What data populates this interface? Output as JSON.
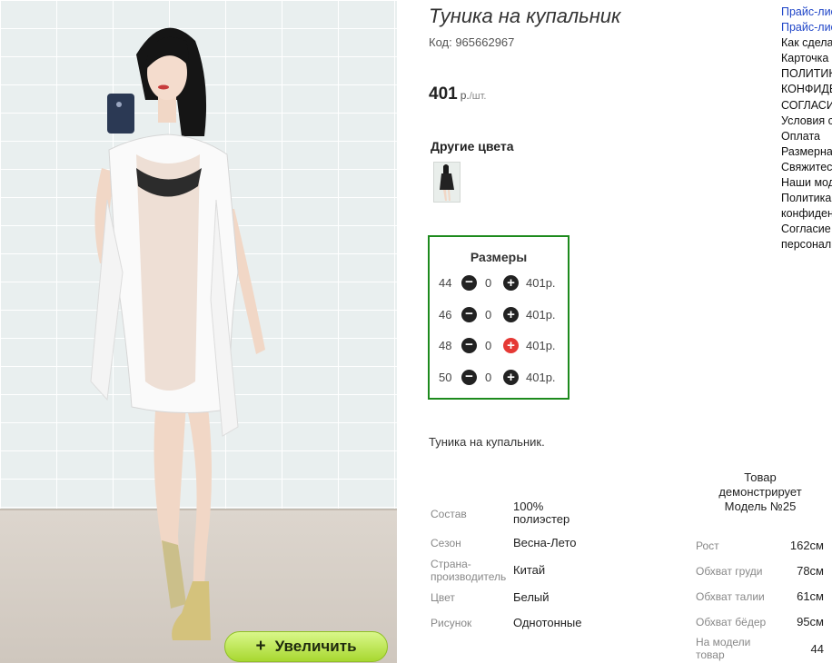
{
  "photo": {
    "zoom_button_label": "Увеличить",
    "zoom_button_icon": "plus-icon"
  },
  "product": {
    "title": "Туника на купальник",
    "code": "Код: 965662967",
    "price": "401",
    "price_unit_currency": "р.",
    "price_unit_piece": "/шт.",
    "other_colors_label": "Другие цвета",
    "sizes_title": "Размеры",
    "sizes": [
      {
        "size": "44",
        "count": "0",
        "price": "401р."
      },
      {
        "size": "46",
        "count": "0",
        "price": "401р."
      },
      {
        "size": "48",
        "count": "0",
        "price": "401р."
      },
      {
        "size": "50",
        "count": "0",
        "price": "401р."
      }
    ],
    "description": "Туника на купальник.",
    "attributes": [
      {
        "label": "Состав",
        "value": "100% полиэстер"
      },
      {
        "label": "Сезон",
        "value": "Весна-Лето"
      },
      {
        "label": "Страна-производитель",
        "value": "Китай"
      },
      {
        "label": "Цвет",
        "value": "Белый"
      },
      {
        "label": "Рисунок",
        "value": "Однотонные"
      }
    ]
  },
  "model": {
    "heading": "Товар демонстрирует Модель №25",
    "measurements": [
      {
        "label": "Рост",
        "value": "162см"
      },
      {
        "label": "Обхват груди",
        "value": "78см"
      },
      {
        "label": "Обхват талии",
        "value": "61см"
      },
      {
        "label": "Обхват бёдер",
        "value": "95см"
      },
      {
        "label": "На модели товар",
        "value": "44"
      }
    ]
  },
  "side_links": [
    {
      "label": "Прайс-лист",
      "link": true
    },
    {
      "label": "Прайс-лист",
      "link": true
    },
    {
      "label": "Как сделать заказ",
      "link": false
    },
    {
      "label": "Карточка",
      "link": false
    },
    {
      "label": "ПОЛИТИКА",
      "link": false
    },
    {
      "label": "КОНФИДЕНЦИАЛЬНОСТИ",
      "link": false
    },
    {
      "label": "СОГЛАСИЕ",
      "link": false
    },
    {
      "label": "Условия сотрудничества",
      "link": false
    },
    {
      "label": "Оплата",
      "link": false
    },
    {
      "label": "Размерная сетка",
      "link": false
    },
    {
      "label": "Свяжитесь с нами",
      "link": false
    },
    {
      "label": "Наши модели",
      "link": false
    },
    {
      "label": "Политика",
      "link": false
    },
    {
      "label": "конфиденциальности",
      "link": false
    },
    {
      "label": "Согласие на обработку",
      "link": false
    },
    {
      "label": "персональных данных",
      "link": false
    }
  ],
  "colors": {
    "sizes_border": "#1d8a1d",
    "zoom_button": "#b5e23c",
    "link": "#1f45c8",
    "plus_active": "#e53935"
  }
}
